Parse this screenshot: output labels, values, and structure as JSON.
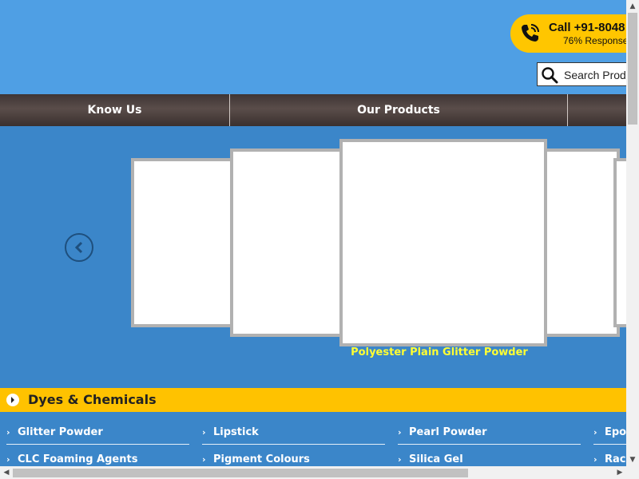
{
  "header": {
    "call_text": "Call +91-8048",
    "response_rate": "76% Response",
    "search_placeholder": "Search Prod"
  },
  "nav": {
    "items": [
      {
        "label": "Know Us"
      },
      {
        "label": "Our Products"
      }
    ]
  },
  "slider": {
    "caption": "Polyester Plain Glitter Powder"
  },
  "category": {
    "title": "Dyes & Chemicals",
    "links_row1": [
      "Glitter Powder",
      "Lipstick",
      "Pearl Powder",
      "Epo"
    ],
    "links_row2": [
      "CLC Foaming Agents",
      "Pigment Colours",
      "Silica Gel",
      "Rac"
    ]
  },
  "colors": {
    "header_bg": "#4f9fe4",
    "body_bg": "#3b86c9",
    "accent_yellow": "#ffc200",
    "caption_yellow": "#ffff33",
    "nav_dark": "#4a3f3d"
  },
  "icons": [
    "phone-icon",
    "search-icon",
    "chevron-left-icon",
    "chevron-right-icon"
  ]
}
